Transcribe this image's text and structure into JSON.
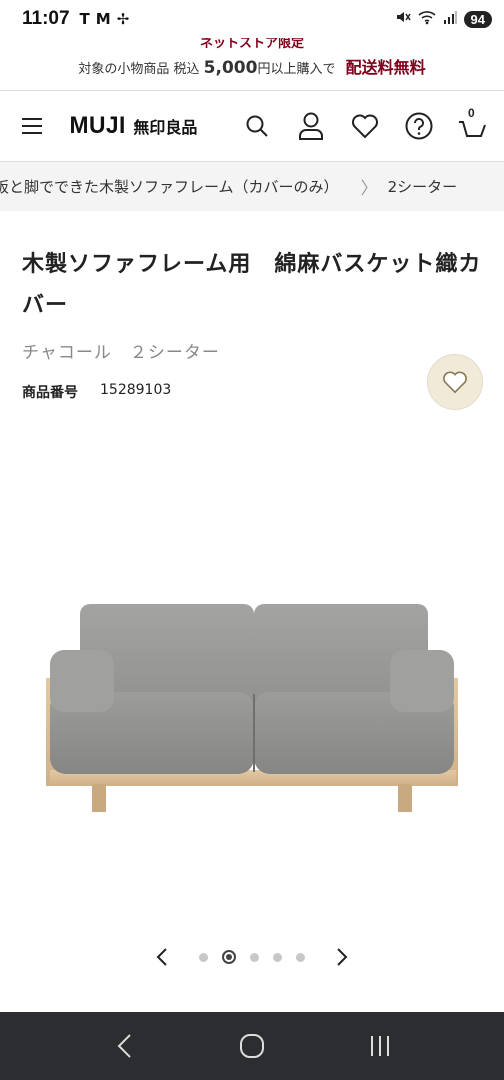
{
  "status_bar": {
    "time": "11:07",
    "left_icons": [
      "tesla-icon",
      "gmail-icon",
      "fan-icon"
    ],
    "right_icons": [
      "mute-icon",
      "wifi-icon",
      "signal-icon"
    ],
    "battery": "94"
  },
  "promo": {
    "top_text": "ネットストア限定",
    "line_prefix": "対象の小物商品 税込",
    "amount": "5,000",
    "line_suffix": "円以上購入で",
    "free_shipping": "配送料無料"
  },
  "header": {
    "logo_en": "MUJI",
    "logo_jp": "無印良品",
    "cart_count": "0",
    "icons": [
      "search-icon",
      "account-icon",
      "favorite-icon",
      "help-icon",
      "cart-icon"
    ]
  },
  "breadcrumb": {
    "item1": "板と脚でできた木製ソファフレーム（カバーのみ）",
    "separator": "〉",
    "item2": "2シーター"
  },
  "product": {
    "title": "木製ソファフレーム用　綿麻バスケット織カバー",
    "variant": "チャコール　２シーター",
    "sku_label": "商品番号",
    "sku_value": "15289103"
  },
  "carousel": {
    "total": 5,
    "active_index": 1
  },
  "colors": {
    "brand_red": "#7f0019",
    "fav_bg": "#f2ead9",
    "nav_bg": "#2b2d31"
  }
}
